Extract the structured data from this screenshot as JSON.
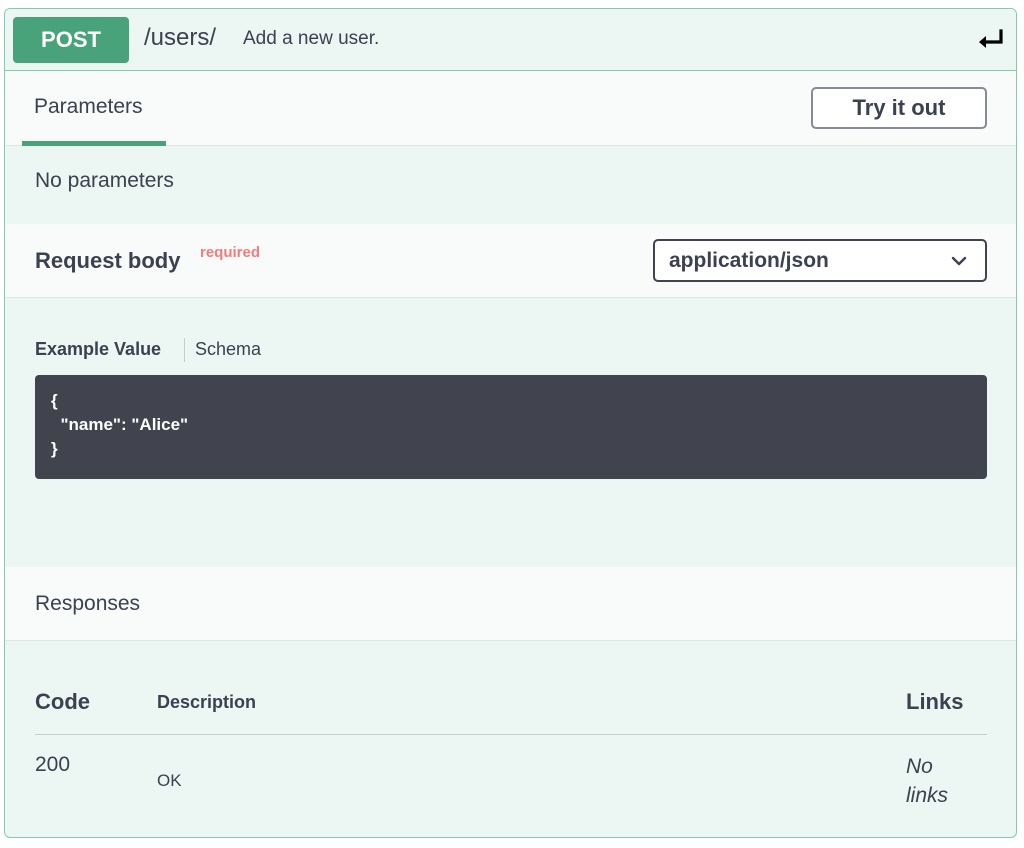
{
  "summary": {
    "method": "POST",
    "path": "/users/",
    "description": "Add a new user.",
    "collapse_icon": "return-arrow-icon"
  },
  "parameters": {
    "tab_label": "Parameters",
    "try_it_out_label": "Try it out",
    "empty_text": "No parameters"
  },
  "request_body": {
    "title": "Request body",
    "required_label": "required",
    "content_type": "application/json",
    "example_tab": "Example Value",
    "schema_tab": "Schema",
    "example_lines": [
      "{",
      "  \"name\": \"Alice\"",
      "}"
    ]
  },
  "responses": {
    "title": "Responses",
    "headers": {
      "code": "Code",
      "description": "Description",
      "links": "Links"
    },
    "rows": [
      {
        "code": "200",
        "description": "OK",
        "links": "No links"
      }
    ]
  },
  "colors": {
    "method_bg": "#49a37a",
    "block_bg": "#ecf6f2",
    "border": "#7fd0a9",
    "required": "#f27d7d",
    "code_bg": "#41444e"
  }
}
